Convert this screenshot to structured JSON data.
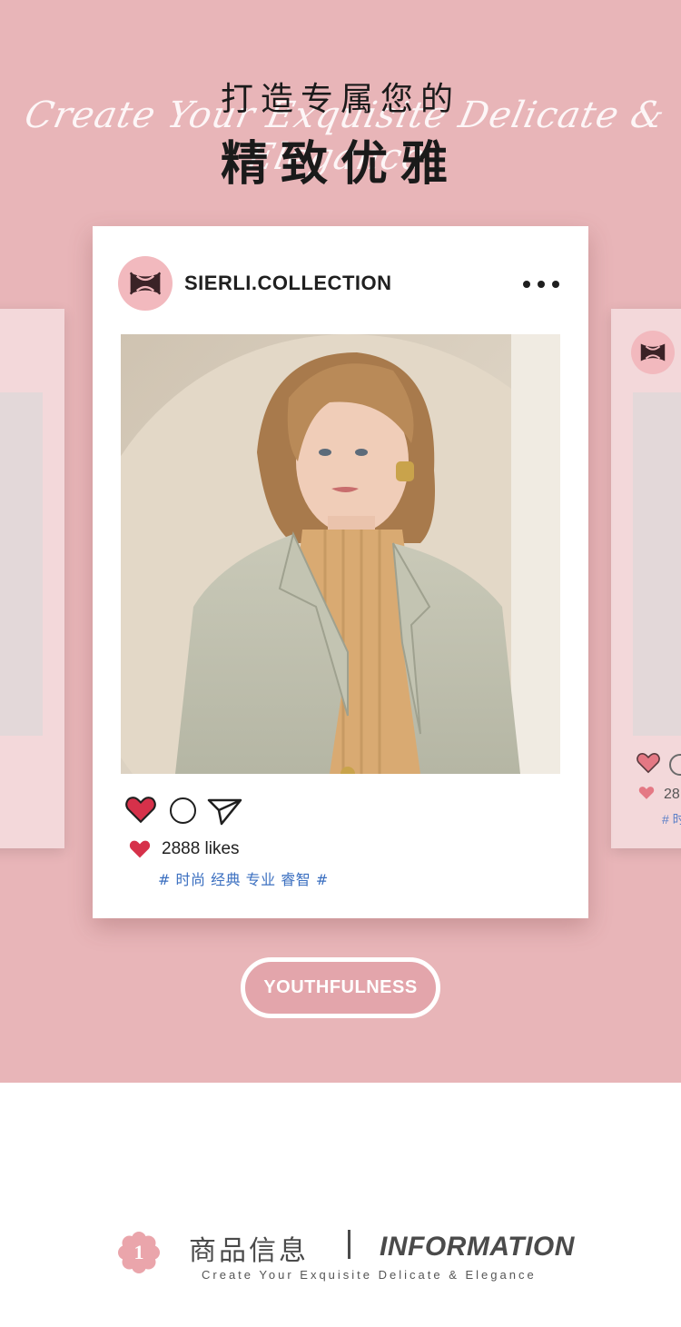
{
  "hero": {
    "title_top": "打造专属您的",
    "title_script": "Create Your Exquisite Delicate & Elegance",
    "title_main": "精致优雅"
  },
  "post": {
    "username": "SIERLI.COLLECTION",
    "likes_text": "2888 likes",
    "tags": "# 时尚 经典 专业 睿智 #"
  },
  "side_post_right": {
    "likes_fragment": "28",
    "tags_fragment": "# 时"
  },
  "pill_label": "YOUTHFULNESS",
  "info": {
    "badge_number": "1",
    "title_cn": "商品信息",
    "title_en": "INFORMATION",
    "subtitle": "Create Your Exquisite Delicate & Elegance"
  },
  "colors": {
    "background_pink": "#e8b5b8",
    "heart_red": "#d6314a",
    "tag_blue": "#3b6fc0",
    "pill_fill": "#e3a5ab",
    "badge_pink": "#eaa5ab"
  },
  "icons": [
    "logo-monogram-icon",
    "more-dots-icon",
    "heart-icon",
    "comment-circle-icon",
    "share-paper-plane-icon",
    "small-heart-icon",
    "flower-badge-icon"
  ]
}
